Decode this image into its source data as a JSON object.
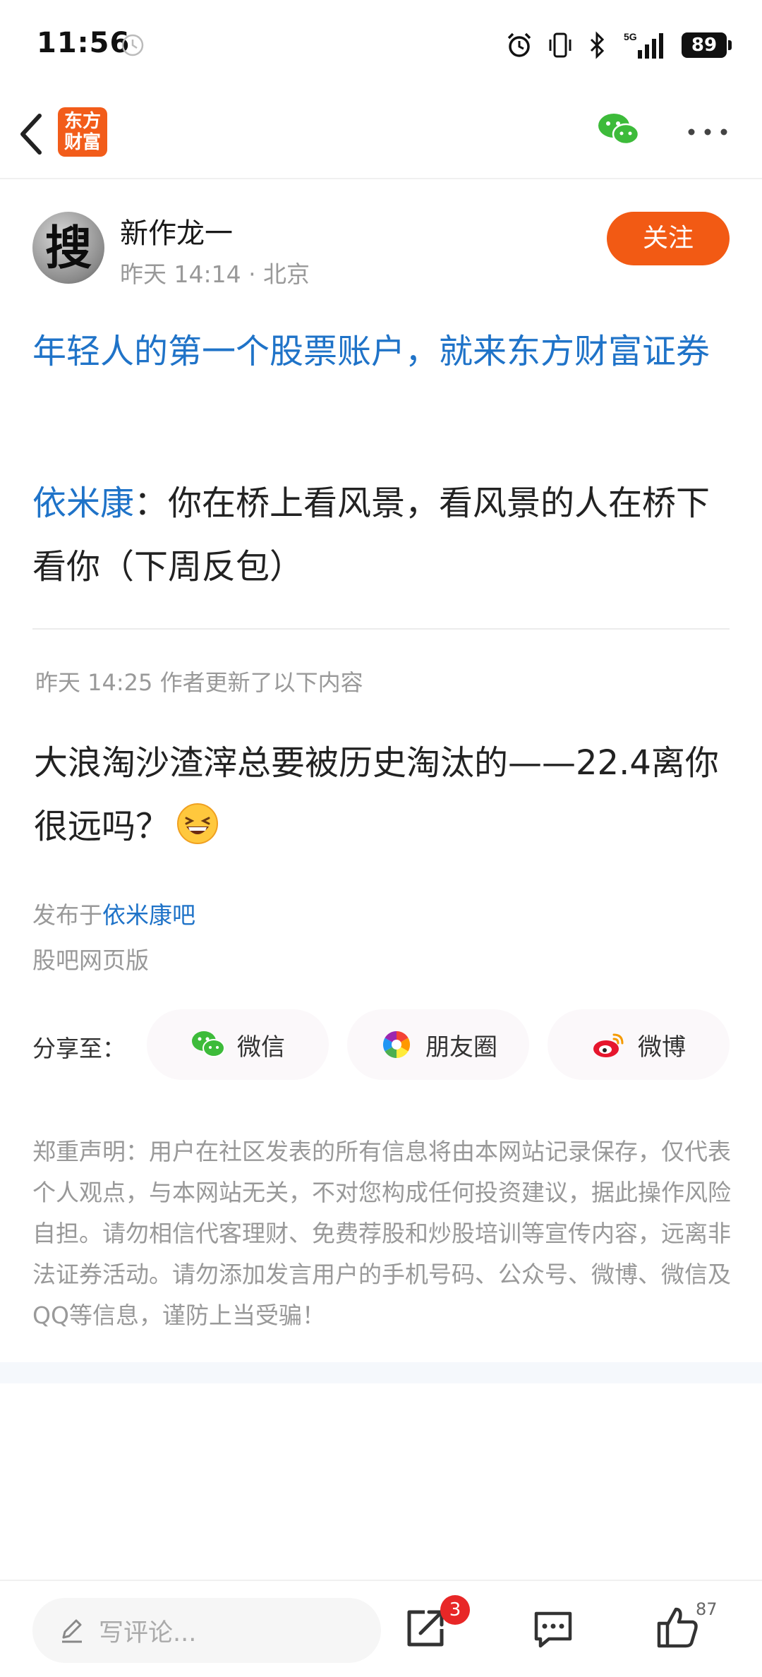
{
  "status_bar": {
    "time": "11:56",
    "battery": "89",
    "network": "5G"
  },
  "nav": {
    "logo_line1": "东方",
    "logo_line2": "财富"
  },
  "author": {
    "avatar_char": "搜",
    "name": "新作龙一",
    "meta": "昨天 14:14 · 北京",
    "follow_label": "关注"
  },
  "article": {
    "headline": "年轻人的第一个股票账户，就来东方财富证券",
    "quote_mention": "依米康",
    "quote_text": "：你在桥上看风景，看风景的人在桥下看你（下周反包）",
    "update_note": "昨天 14:25  作者更新了以下内容",
    "update_body": "大浪淘沙渣滓总要被历史淘汰的——22.4离你很远吗？",
    "published_prefix": "发布于",
    "forum_link": "依米康吧",
    "web_version": "股吧网页版"
  },
  "share": {
    "label": "分享至：",
    "buttons": [
      {
        "label": "微信",
        "icon": "wechat-icon"
      },
      {
        "label": "朋友圈",
        "icon": "moments-icon"
      },
      {
        "label": "微博",
        "icon": "weibo-icon"
      }
    ]
  },
  "disclaimer": "郑重声明：用户在社区发表的所有信息将由本网站记录保存，仅代表个人观点，与本网站无关，不对您构成任何投资建议，据此操作风险自担。请勿相信代客理财、免费荐股和炒股培训等宣传内容，远离非法证券活动。请勿添加发言用户的手机号码、公众号、微博、微信及QQ等信息，谨防上当受骗！",
  "bottom_bar": {
    "comment_placeholder": "写评论...",
    "share_badge": "3",
    "like_count": "87"
  },
  "colors": {
    "accent": "#f25a14",
    "link": "#1f73c8",
    "wechat": "#3dbb3a",
    "badge": "#e82727"
  }
}
